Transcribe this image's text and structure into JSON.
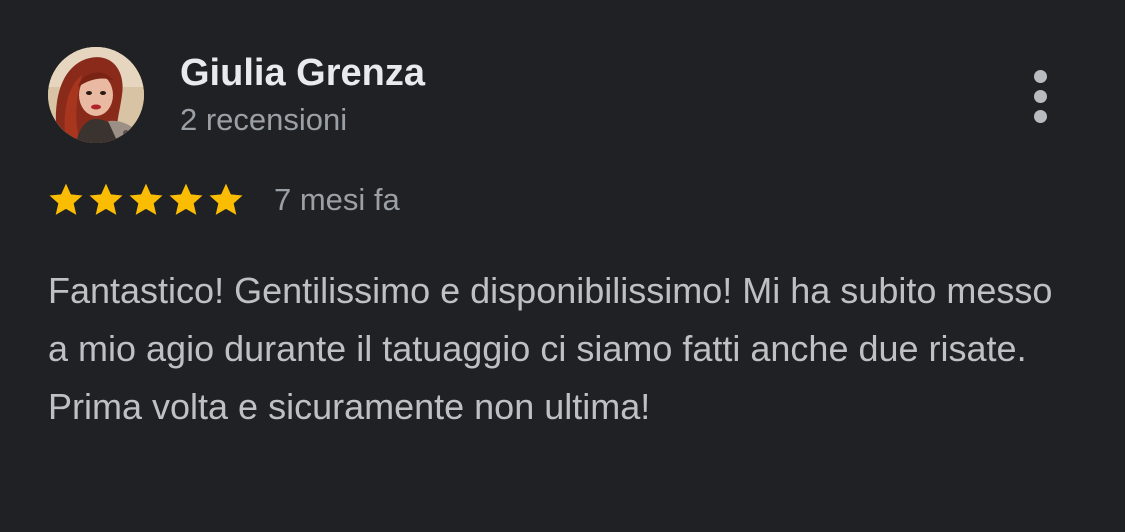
{
  "review": {
    "author_name": "Giulia Grenza",
    "review_count": "2 recensioni",
    "rating": 5,
    "rating_max": 5,
    "date": "7 mesi fa",
    "text": "Fantastico! Gentilissimo e disponibilissimo! Mi ha subito messo a mio agio durante il tatuaggio ci siamo fatti anche due risate. Prima volta e sicuramente non ultima!"
  },
  "icons": {
    "more": "more-vert-icon",
    "star": "star-icon"
  },
  "colors": {
    "background": "#202124",
    "name": "#e8eaed",
    "secondary": "#9aa0a6",
    "body_text": "#bdc1c6",
    "star": "#fbbc04"
  }
}
